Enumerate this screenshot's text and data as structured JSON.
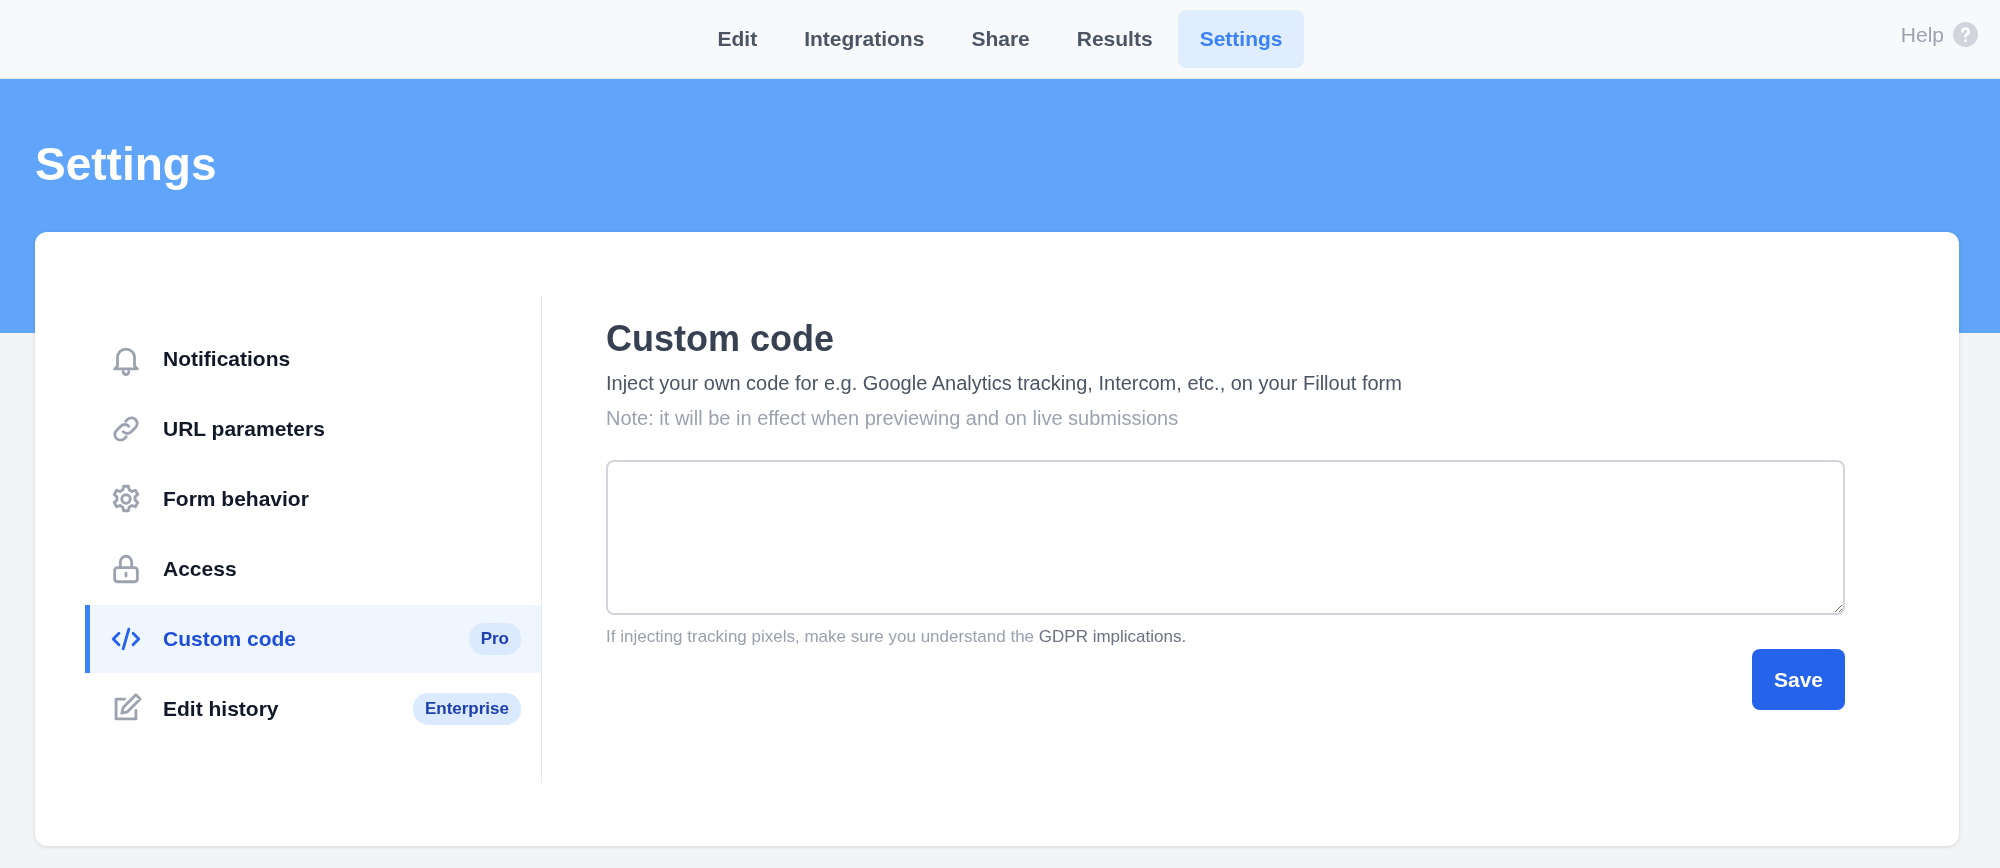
{
  "nav": {
    "tabs": [
      {
        "label": "Edit",
        "selected": false
      },
      {
        "label": "Integrations",
        "selected": false
      },
      {
        "label": "Share",
        "selected": false
      },
      {
        "label": "Results",
        "selected": false
      },
      {
        "label": "Settings",
        "selected": true
      }
    ],
    "help": {
      "label": "Help"
    }
  },
  "page_title": "Settings",
  "sidebar": {
    "items": [
      {
        "label": "Notifications",
        "selected": false
      },
      {
        "label": "URL parameters",
        "selected": false
      },
      {
        "label": "Form behavior",
        "selected": false
      },
      {
        "label": "Access",
        "selected": false
      },
      {
        "label": "Custom code",
        "selected": true,
        "badge": "Pro"
      },
      {
        "label": "Edit history",
        "selected": false,
        "badge": "Enterprise"
      }
    ]
  },
  "content": {
    "title": "Custom code",
    "description": "Inject your own code for e.g. Google Analytics tracking, Intercom, etc., on your Fillout form",
    "note": "Note: it will be in effect when previewing and on live submissions",
    "hint": {
      "text": "If injecting tracking pixels, make sure you understand the",
      "link": "GDPR implications."
    },
    "save_button": "Save"
  }
}
